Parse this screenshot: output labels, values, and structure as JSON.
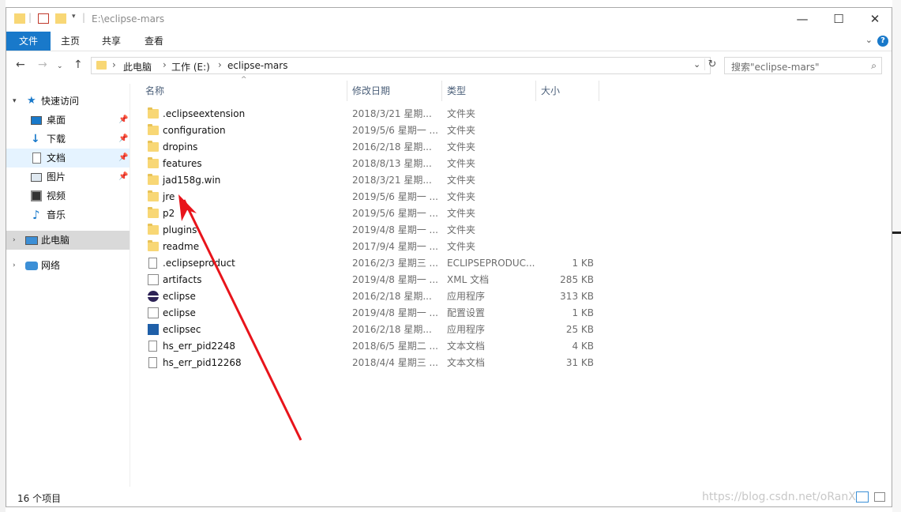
{
  "window": {
    "title": "E:\\eclipse-mars",
    "controls": {
      "minimize": "—",
      "maximize": "☐",
      "close": "✕"
    }
  },
  "ribbon": {
    "tabs": [
      "文件",
      "主页",
      "共享",
      "查看"
    ],
    "help": "?",
    "collapse": "⌄"
  },
  "address": {
    "crumbs": [
      "此电脑",
      "工作 (E:)",
      "eclipse-mars"
    ],
    "search_placeholder": "搜索\"eclipse-mars\""
  },
  "nav": {
    "quick_access": "快速访问",
    "pinned": [
      {
        "label": "桌面",
        "icon": "desktop-icon",
        "pinned": true
      },
      {
        "label": "下载",
        "icon": "download-icon",
        "pinned": true
      },
      {
        "label": "文档",
        "icon": "document-icon",
        "pinned": true
      },
      {
        "label": "图片",
        "icon": "picture-icon",
        "pinned": true
      },
      {
        "label": "视频",
        "icon": "video-icon",
        "pinned": false
      },
      {
        "label": "音乐",
        "icon": "music-icon",
        "pinned": false
      }
    ],
    "this_pc": "此电脑",
    "network": "网络"
  },
  "columns": {
    "name": "名称",
    "date": "修改日期",
    "type": "类型",
    "size": "大小"
  },
  "files": [
    {
      "name": ".eclipseextension",
      "date": "2018/3/21 星期...",
      "type": "文件夹",
      "size": "",
      "icon": "folder"
    },
    {
      "name": "configuration",
      "date": "2019/5/6 星期一 ...",
      "type": "文件夹",
      "size": "",
      "icon": "folder"
    },
    {
      "name": "dropins",
      "date": "2016/2/18 星期...",
      "type": "文件夹",
      "size": "",
      "icon": "folder"
    },
    {
      "name": "features",
      "date": "2018/8/13 星期...",
      "type": "文件夹",
      "size": "",
      "icon": "folder"
    },
    {
      "name": "jad158g.win",
      "date": "2018/3/21 星期...",
      "type": "文件夹",
      "size": "",
      "icon": "folder"
    },
    {
      "name": "jre",
      "date": "2019/5/6 星期一 ...",
      "type": "文件夹",
      "size": "",
      "icon": "folder"
    },
    {
      "name": "p2",
      "date": "2019/5/6 星期一 ...",
      "type": "文件夹",
      "size": "",
      "icon": "folder"
    },
    {
      "name": "plugins",
      "date": "2019/4/8 星期一 ...",
      "type": "文件夹",
      "size": "",
      "icon": "folder"
    },
    {
      "name": "readme",
      "date": "2017/9/4 星期一 ...",
      "type": "文件夹",
      "size": "",
      "icon": "folder"
    },
    {
      "name": ".eclipseproduct",
      "date": "2016/2/3 星期三 ...",
      "type": "ECLIPSEPRODUC...",
      "size": "1 KB",
      "icon": "doc"
    },
    {
      "name": "artifacts",
      "date": "2019/4/8 星期一 ...",
      "type": "XML 文档",
      "size": "285 KB",
      "icon": "cfg"
    },
    {
      "name": "eclipse",
      "date": "2016/2/18 星期...",
      "type": "应用程序",
      "size": "313 KB",
      "icon": "eclipse"
    },
    {
      "name": "eclipse",
      "date": "2019/4/8 星期一 ...",
      "type": "配置设置",
      "size": "1 KB",
      "icon": "cfg"
    },
    {
      "name": "eclipsec",
      "date": "2016/2/18 星期...",
      "type": "应用程序",
      "size": "25 KB",
      "icon": "app"
    },
    {
      "name": "hs_err_pid2248",
      "date": "2018/6/5 星期二 ...",
      "type": "文本文档",
      "size": "4 KB",
      "icon": "doc"
    },
    {
      "name": "hs_err_pid12268",
      "date": "2018/4/4 星期三 ...",
      "type": "文本文档",
      "size": "31 KB",
      "icon": "doc"
    }
  ],
  "status": {
    "count": "16 个项目"
  },
  "watermark": "https://blog.csdn.net/oRanX",
  "colors": {
    "accent": "#1979ca",
    "selection": "#cce8ff",
    "folder": "#f8d775",
    "arrow": "#e8141b"
  }
}
